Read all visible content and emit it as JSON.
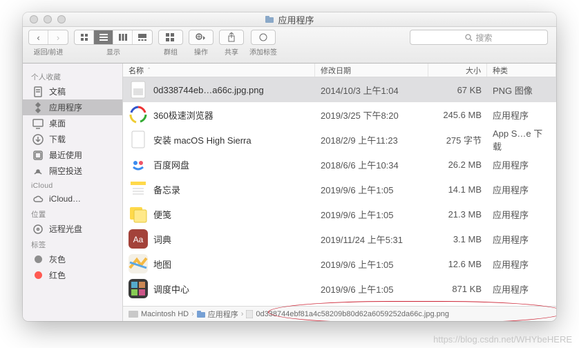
{
  "window": {
    "title": "应用程序"
  },
  "toolbar": {
    "back_forward_label": "返回/前进",
    "view_label": "显示",
    "group_label": "群组",
    "action_label": "操作",
    "share_label": "共享",
    "tags_label": "添加标签",
    "search_placeholder": "搜索"
  },
  "sidebar": {
    "favorites": {
      "header": "个人收藏",
      "items": [
        {
          "label": "文稿",
          "icon": "doc-icon"
        },
        {
          "label": "应用程序",
          "icon": "apps-icon",
          "selected": true
        },
        {
          "label": "桌面",
          "icon": "desktop-icon"
        },
        {
          "label": "下载",
          "icon": "downloads-icon"
        },
        {
          "label": "最近使用",
          "icon": "recents-icon"
        },
        {
          "label": "隔空投送",
          "icon": "airdrop-icon"
        }
      ]
    },
    "icloud": {
      "header": "iCloud",
      "items": [
        {
          "label": "iCloud…",
          "icon": "cloud-icon"
        }
      ]
    },
    "locations": {
      "header": "位置",
      "items": [
        {
          "label": "远程光盘",
          "icon": "disc-icon"
        }
      ]
    },
    "tags": {
      "header": "标签",
      "items": [
        {
          "label": "灰色",
          "color": "#8e8e8e"
        },
        {
          "label": "红色",
          "color": "#ff5a52"
        }
      ]
    }
  },
  "columns": {
    "name": "名称",
    "date": "修改日期",
    "size": "大小",
    "kind": "种类"
  },
  "files": [
    {
      "name": "0d338744eb…a66c.jpg.png",
      "date": "2014/10/3 上午1:04",
      "size": "67 KB",
      "kind": "PNG 图像",
      "icon": "png",
      "selected": true
    },
    {
      "name": "360极速浏览器",
      "date": "2019/3/25 下午8:20",
      "size": "245.6 MB",
      "kind": "应用程序",
      "icon": "360"
    },
    {
      "name": "安装 macOS High Sierra",
      "date": "2018/2/9 上午11:23",
      "size": "275 字节",
      "kind": "App S…e 下载",
      "icon": "blank"
    },
    {
      "name": "百度网盘",
      "date": "2018/6/6 上午10:34",
      "size": "26.2 MB",
      "kind": "应用程序",
      "icon": "baidu"
    },
    {
      "name": "备忘录",
      "date": "2019/9/6 上午1:05",
      "size": "14.1 MB",
      "kind": "应用程序",
      "icon": "notes"
    },
    {
      "name": "便笺",
      "date": "2019/9/6 上午1:05",
      "size": "21.3 MB",
      "kind": "应用程序",
      "icon": "stickies"
    },
    {
      "name": "词典",
      "date": "2019/11/24 上午5:31",
      "size": "3.1 MB",
      "kind": "应用程序",
      "icon": "dict"
    },
    {
      "name": "地图",
      "date": "2019/9/6 上午1:05",
      "size": "12.6 MB",
      "kind": "应用程序",
      "icon": "maps"
    },
    {
      "name": "调度中心",
      "date": "2019/9/6 上午1:05",
      "size": "871 KB",
      "kind": "应用程序",
      "icon": "mission"
    }
  ],
  "pathbar": {
    "hd": "Macintosh HD",
    "folder": "应用程序",
    "file": "0d338744ebf81a4c58209b80d62a6059252da66c.jpg.png"
  },
  "watermark": "https://blog.csdn.net/WHYbeHERE"
}
